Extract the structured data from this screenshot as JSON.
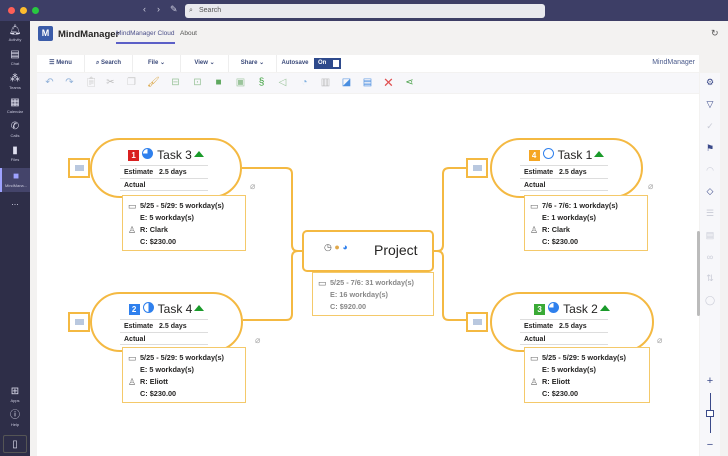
{
  "window": {
    "search_placeholder": "Search"
  },
  "rail": [
    {
      "label": "Activity",
      "icon": "bell-icon"
    },
    {
      "label": "Chat",
      "icon": "chat-icon"
    },
    {
      "label": "Teams",
      "icon": "teams-icon"
    },
    {
      "label": "Calendar",
      "icon": "calendar-icon"
    },
    {
      "label": "Calls",
      "icon": "phone-icon"
    },
    {
      "label": "Files",
      "icon": "file-icon"
    },
    {
      "label": "MindMana...",
      "icon": "mindmanager-icon",
      "selected": true
    },
    {
      "label": "...",
      "icon": "more-icon"
    }
  ],
  "rail_bottom": [
    {
      "label": "Apps"
    },
    {
      "label": "Help"
    }
  ],
  "app": {
    "logo": "M",
    "name": "MindManager",
    "tabs": [
      "MindManager Cloud",
      "About"
    ],
    "active_tab": "MindManager Cloud"
  },
  "toolbar": {
    "menu": "Menu",
    "search": "Search",
    "file": "File",
    "view": "View",
    "share": "Share",
    "autosave": "Autosave",
    "autosave_state": "On",
    "brand": "MindManager"
  },
  "colors": {
    "accent": "#f4b942",
    "brand": "#3a5ba8",
    "titlebar": "#3d3e66"
  },
  "project": {
    "title": "Project",
    "dates": "5/25 - 7/6: 31 workday(s)",
    "effort": "E: 16 workday(s)",
    "cost": "C: $920.00"
  },
  "tasks": [
    {
      "title": "Task 3",
      "priority": "1",
      "priority_color": "#d92020",
      "progress": 75,
      "estimate_label": "Estimate",
      "estimate": "2.5 days",
      "actual_label": "Actual",
      "dates": "5/25 - 5/29: 5 workday(s)",
      "effort": "E: 5 workday(s)",
      "resource": "R: Clark",
      "cost": "C: $230.00"
    },
    {
      "title": "Task 4",
      "priority": "2",
      "priority_color": "#2f80ed",
      "progress": 50,
      "estimate_label": "Estimate",
      "estimate": "2.5 days",
      "actual_label": "Actual",
      "dates": "5/25 - 5/29: 5 workday(s)",
      "effort": "E: 5 workday(s)",
      "resource": "R: Eliott",
      "cost": "C: $230.00"
    },
    {
      "title": "Task 1",
      "priority": "4",
      "priority_color": "#f5a623",
      "progress": 0,
      "estimate_label": "Estimate",
      "estimate": "2.5 days",
      "actual_label": "Actual",
      "dates": "7/6 - 7/6: 1 workday(s)",
      "effort": "E: 1 workday(s)",
      "resource": "R: Clark",
      "cost": "C: $230.00"
    },
    {
      "title": "Task 2",
      "priority": "3",
      "priority_color": "#3aaa35",
      "progress": 75,
      "estimate_label": "Estimate",
      "estimate": "2.5 days",
      "actual_label": "Actual",
      "dates": "5/25 - 5/29: 5 workday(s)",
      "effort": "E: 5 workday(s)",
      "resource": "R: Eliott",
      "cost": "C: $230.00"
    }
  ]
}
